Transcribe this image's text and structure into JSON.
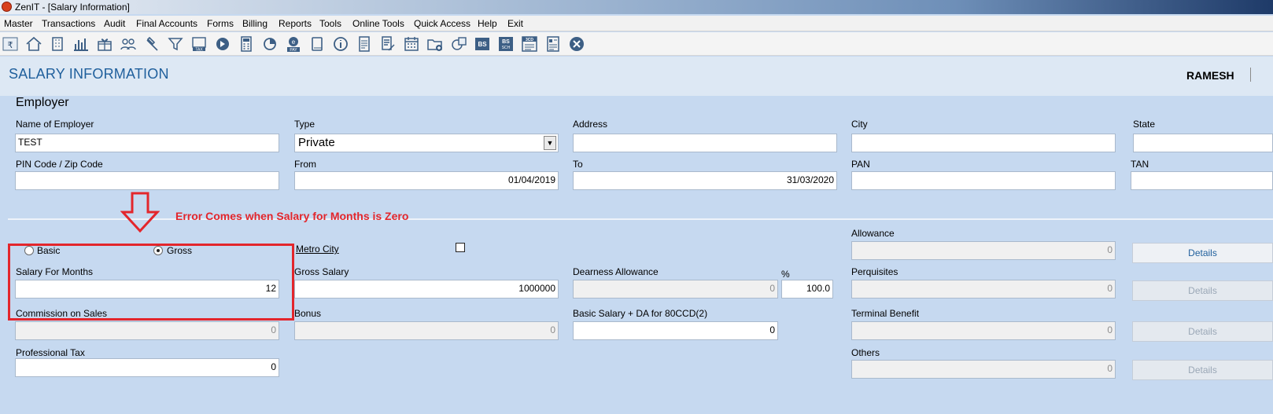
{
  "window": {
    "title": "ZenIT - [Salary Information]"
  },
  "menu": [
    "Master",
    "Transactions",
    "Audit",
    "Final Accounts",
    "Forms",
    "Billing",
    "Reports",
    "Tools",
    "Online Tools",
    "Quick Access",
    "Help",
    "Exit"
  ],
  "toolbar_icons": [
    "rupee-book-icon",
    "home-icon",
    "building-icon",
    "bar-chart-icon",
    "gift-icon",
    "users-icon",
    "gavel-icon",
    "filter-icon",
    "tax-icon",
    "arrow-circle-icon",
    "calculator-icon",
    "pie-icon",
    "pay-icon",
    "book-icon",
    "info-icon",
    "document-icon",
    "document-edit-icon",
    "calendar-icon",
    "folder-add-icon",
    "copy-icon",
    "bs-icon",
    "bs-sch-icon",
    "3cd-icon",
    "report-icon",
    "close-icon"
  ],
  "header": {
    "title": "SALARY INFORMATION",
    "user": "RAMESH"
  },
  "employer": {
    "section_title": "Employer",
    "name_label": "Name of Employer",
    "name_value": "TEST",
    "type_label": "Type",
    "type_value": "Private",
    "address_label": "Address",
    "address_value": "",
    "city_label": "City",
    "city_value": "",
    "state_label": "State",
    "state_value": "",
    "pin_label": "PIN Code / Zip Code",
    "pin_value": "",
    "from_label": "From",
    "from_value": "01/04/2019",
    "to_label": "To",
    "to_value": "31/03/2020",
    "pan_label": "PAN",
    "pan_value": "",
    "tan_label": "TAN",
    "tan_value": ""
  },
  "salary": {
    "basic_label": "Basic",
    "gross_label": "Gross",
    "selected": "Gross",
    "metro_label": "Metro City",
    "metro_checked": false,
    "months_label": "Salary For Months",
    "months_value": "12",
    "gross_salary_label": "Gross Salary",
    "gross_salary_value": "1000000",
    "da_label": "Dearness Allowance",
    "da_value": "0",
    "pct_label": "%",
    "pct_value": "100.0",
    "commission_label": "Commission on Sales",
    "commission_value": "0",
    "bonus_label": "Bonus",
    "bonus_value": "0",
    "basic_da_label": "Basic Salary + DA for 80CCD(2)",
    "basic_da_value": "0",
    "prof_tax_label": "Professional Tax",
    "prof_tax_value": "0",
    "allowance_label": "Allowance",
    "allowance_value": "0",
    "perquisites_label": "Perquisites",
    "perquisites_value": "0",
    "terminal_label": "Terminal Benefit",
    "terminal_value": "0",
    "others_label": "Others",
    "others_value": "0",
    "details_label": "Details"
  },
  "annotation": {
    "text": "Error Comes when Salary for Months is Zero",
    "color": "#e3262c"
  }
}
